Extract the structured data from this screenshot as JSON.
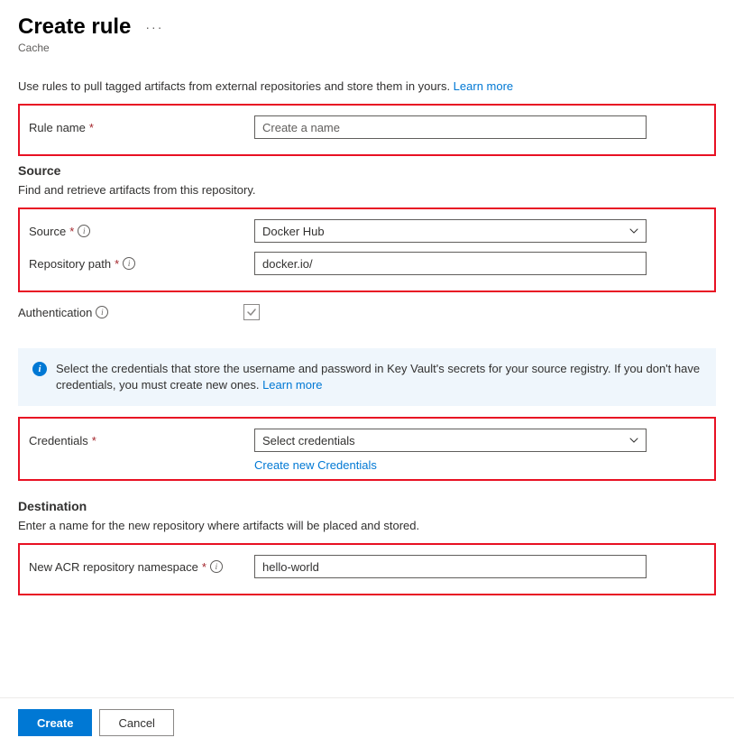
{
  "title": "Create rule",
  "subtitle": "Cache",
  "intro_text": "Use rules to pull tagged artifacts from external repositories and store them in yours. ",
  "intro_link": "Learn more",
  "fields": {
    "rule_name": {
      "label": "Rule name",
      "placeholder": "Create a name",
      "value": ""
    },
    "source": {
      "label": "Source",
      "selected": "Docker Hub"
    },
    "repo_path": {
      "label": "Repository path",
      "value": "docker.io/"
    },
    "authentication": {
      "label": "Authentication",
      "checked": true
    },
    "credentials": {
      "label": "Credentials",
      "selected": "Select credentials",
      "create_link": "Create new Credentials"
    },
    "namespace": {
      "label": "New ACR repository namespace",
      "value": "hello-world"
    }
  },
  "sections": {
    "source_heading": "Source",
    "source_desc": "Find and retrieve artifacts from this repository.",
    "dest_heading": "Destination",
    "dest_desc": "Enter a name for the new repository where artifacts will be placed and stored."
  },
  "banner": {
    "text": "Select the credentials that store the username and password in Key Vault's secrets for your source registry. If you don't have credentials, you must create new ones. ",
    "link": "Learn more"
  },
  "buttons": {
    "create": "Create",
    "cancel": "Cancel"
  }
}
